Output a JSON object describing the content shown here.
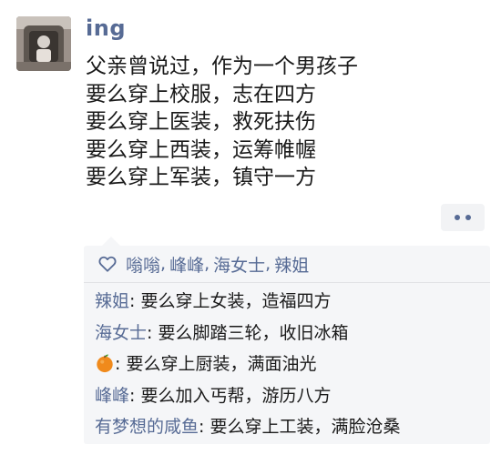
{
  "post": {
    "username": "ing",
    "avatar_icon": "avatar-photo-icon",
    "lines": [
      "父亲曾说过，作为一个男孩子",
      "要么穿上校服，志在四方",
      "要么穿上医装，救死扶伤",
      "要么穿上西装，运筹帷幄",
      "要么穿上军装，镇守一方"
    ]
  },
  "actions": {
    "more_icon": "more-dots-icon"
  },
  "likes": {
    "icon": "heart-icon",
    "names": [
      "嗡嗡",
      "峰峰",
      "海女士",
      "辣姐"
    ],
    "separator": ","
  },
  "comments": [
    {
      "author": "辣姐",
      "colon": ":",
      "text": " 要么穿上女装，造福四方"
    },
    {
      "author": "海女士",
      "colon": ":",
      "text": " 要么脚踏三轮，收旧冰箱"
    },
    {
      "author": "",
      "author_icon": "orange-icon",
      "colon": ":",
      "text": " 要么穿上厨装，满面油光"
    },
    {
      "author": "峰峰",
      "colon": ":",
      "text": " 要么加入丐帮，游历八方"
    },
    {
      "author": "有梦想的咸鱼",
      "colon": ":",
      "text": " 要么穿上工装，满脸沧桑"
    }
  ],
  "colors": {
    "link": "#576b95",
    "text": "#1a1a1a",
    "panel_bg": "#f5f6f8",
    "orange": "#f08a1c"
  }
}
